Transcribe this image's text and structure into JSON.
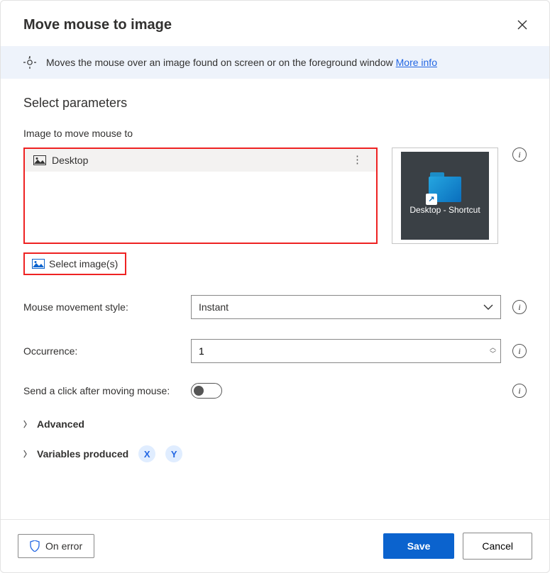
{
  "dialog": {
    "title": "Move mouse to image",
    "banner_text": "Moves the mouse over an image found on screen or on the foreground window ",
    "more_info": "More info",
    "section_title": "Select parameters",
    "image_field_label": "Image to move mouse to",
    "image_item_name": "Desktop",
    "preview_caption": "Desktop - Shortcut",
    "select_images_label": "Select image(s)",
    "mouse_style_label": "Mouse movement style:",
    "mouse_style_value": "Instant",
    "occurrence_label": "Occurrence:",
    "occurrence_value": "1",
    "send_click_label": "Send a click after moving mouse:",
    "advanced_label": "Advanced",
    "variables_label": "Variables produced",
    "var_x": "X",
    "var_y": "Y"
  },
  "footer": {
    "on_error": "On error",
    "save": "Save",
    "cancel": "Cancel"
  }
}
